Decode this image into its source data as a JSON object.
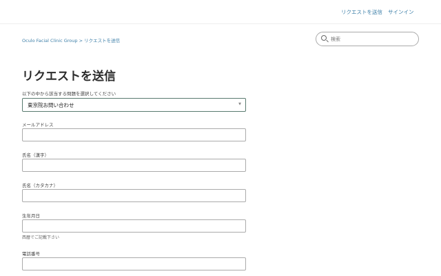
{
  "header": {
    "nav": [
      "リクエストを送信",
      "サインイン"
    ]
  },
  "breadcrumb": "Oculo Facial Clinic Group > リクエストを送信",
  "search": {
    "placeholder": "検索"
  },
  "page_title": "リクエストを送信",
  "form": {
    "issue_label": "以下の中から該当する問題を選択してください",
    "issue_value": "東京院お問い合わせ",
    "email_label": "メールアドレス",
    "name_kanji_label": "氏名（漢字）",
    "name_kana_label": "氏名（カタカナ）",
    "birthdate_label": "生年月日",
    "birthdate_hint": "西暦でご記載下さい",
    "phone_label": "電話番号"
  }
}
